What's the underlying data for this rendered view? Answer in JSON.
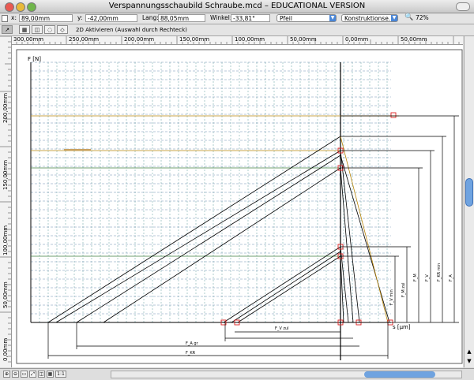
{
  "window": {
    "title": "Verspannungsschaubild Schraube.mcd – EDUCATIONAL VERSION"
  },
  "coordbar": {
    "x_label": "x:",
    "x_value": "89,00mm",
    "y_label": "y:",
    "y_value": "-42,00mm",
    "len_label": "Lang:",
    "len_value": "88,05mm",
    "angle_label": "Winkel:",
    "angle_value": "-33,81°",
    "linestyle_select": "Pfeil",
    "layer_select": "Konstruktionse...",
    "zoom_value": "72%"
  },
  "toolrow": {
    "hint": "2D Aktivieren (Auswahl durch Rechteck)"
  },
  "hruler": {
    "labels": [
      "300,00mm",
      "250,00mm",
      "200,00mm",
      "150,00mm",
      "100,00mm",
      "50,00mm",
      "0,00mm",
      "50,00mm"
    ]
  },
  "vruler": {
    "labels": [
      "200,00mm",
      "150,00mm",
      "100,00mm",
      "50,00mm",
      "0,00mm"
    ]
  },
  "drawing": {
    "y_axis_label": "F [N]",
    "x_axis_label": "s [µm]",
    "dim_labels": [
      "F_A",
      "F_KR min",
      "F_V",
      "F_M",
      "F_M zul",
      "F_V min",
      "F_V zul",
      "F_A gr",
      "F_KR"
    ]
  },
  "status": {
    "buttons": [
      "⊕",
      "⊖",
      "▭",
      "⤢",
      "◫",
      "▦",
      "1:1"
    ]
  }
}
